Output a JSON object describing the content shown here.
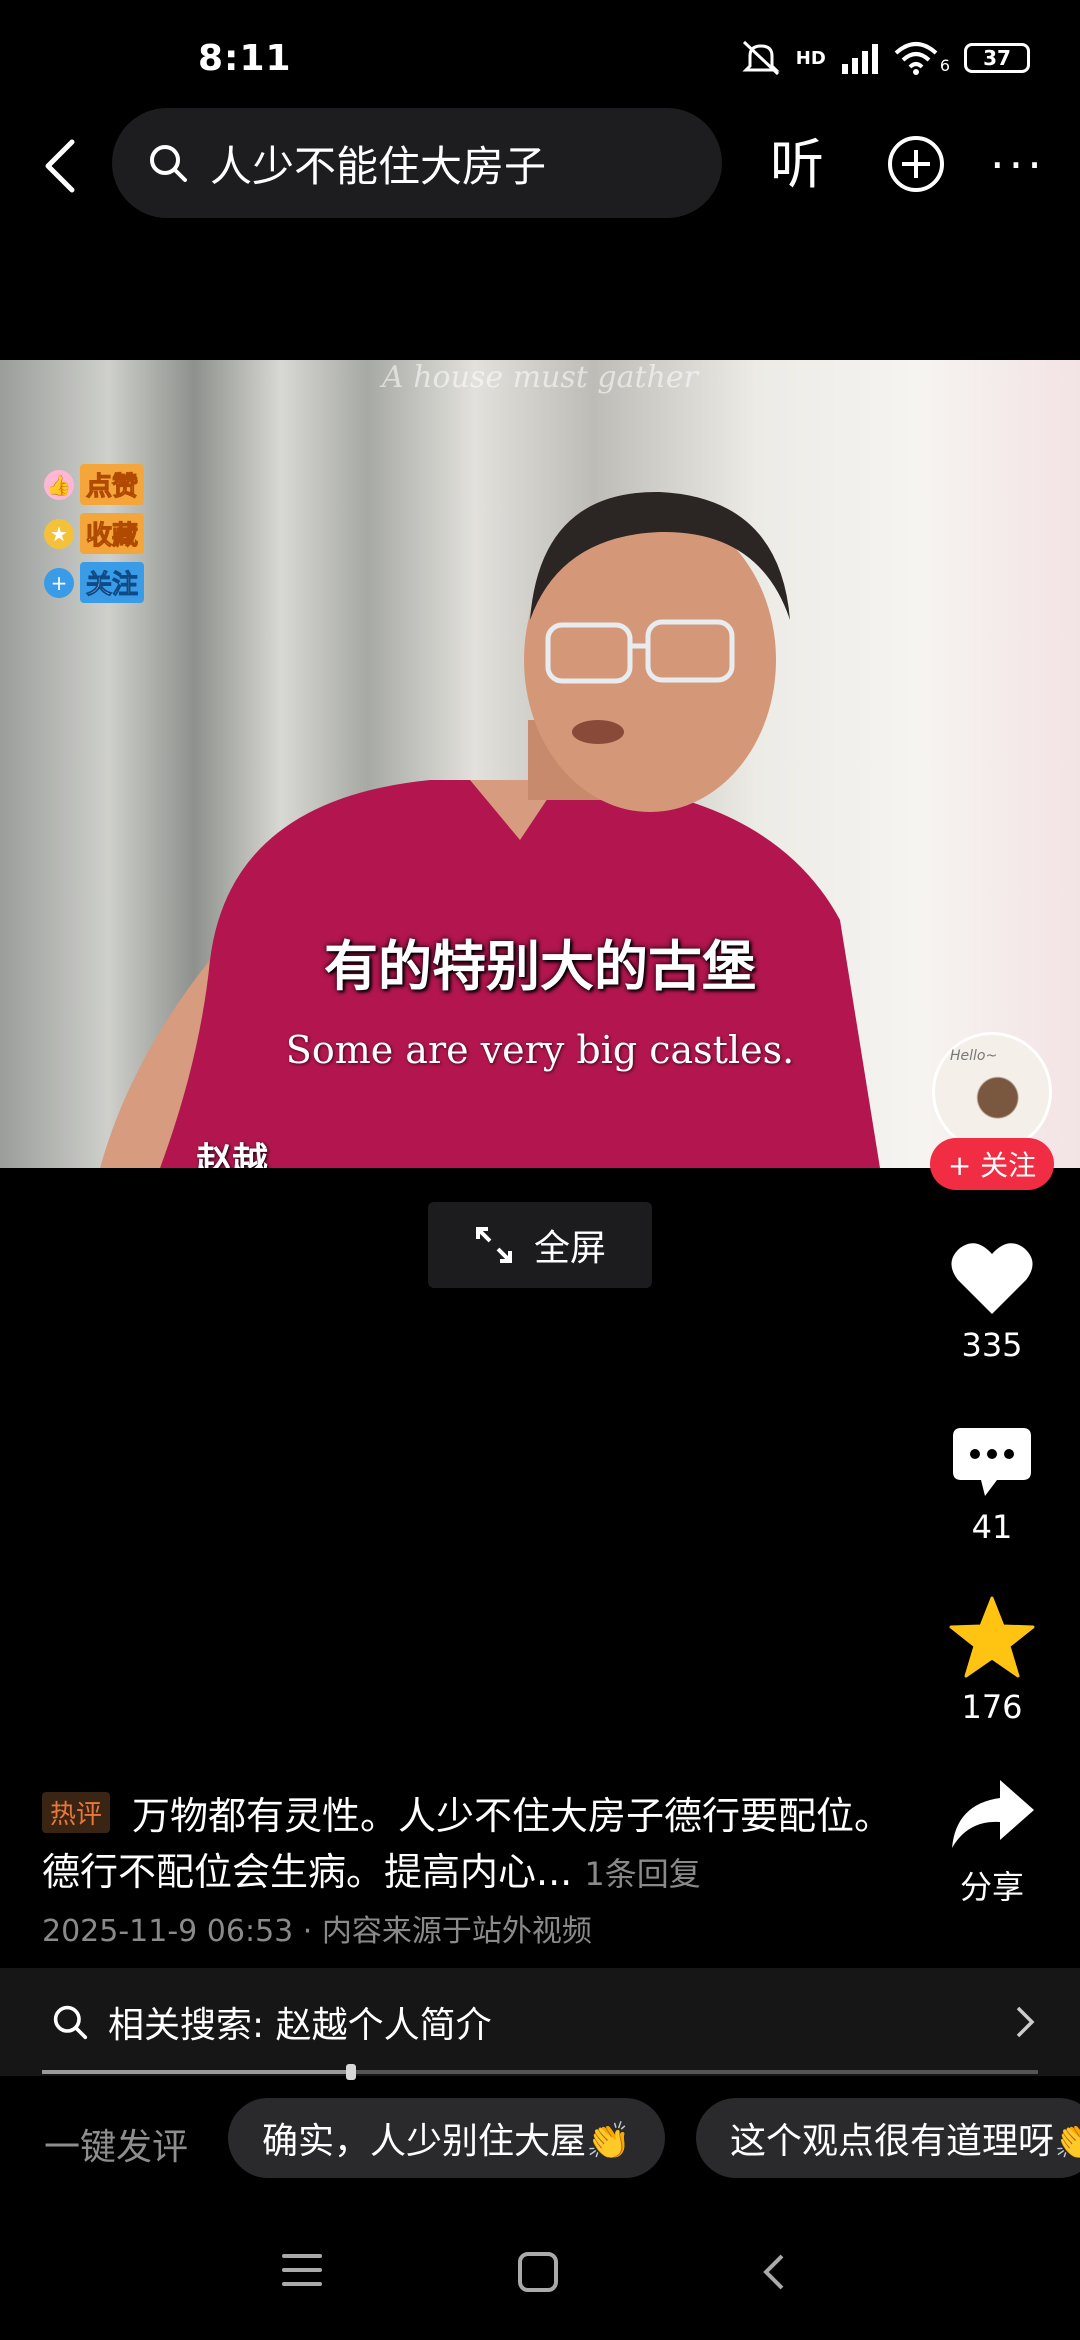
{
  "status_bar": {
    "time": "8:11",
    "battery": "37",
    "network": "HD",
    "wifi_badge": "6"
  },
  "top_bar": {
    "search_query": "人少不能住大房子",
    "listen_label": "听"
  },
  "video": {
    "top_caption": "A house must gather",
    "badges": [
      {
        "icon": "thumbs-up-icon",
        "label": "点赞"
      },
      {
        "icon": "star-icon",
        "label": "收藏"
      },
      {
        "icon": "plus-icon",
        "label": "关注"
      }
    ],
    "caption_cn": "有的特别大的古堡",
    "caption_en": "Some are very big castles.",
    "name_tag": "赵越"
  },
  "fullscreen_label": "全屏",
  "author": {
    "avatar_text": "Hello~",
    "follow_label": "+ 关注"
  },
  "actions": {
    "likes": "335",
    "comments": "41",
    "favorites": "176",
    "share_label": "分享"
  },
  "hot_comment": {
    "badge": "热评",
    "text": "万物都有灵性。人少不住大房子德行要配位。德行不配位会生病。提高内心...",
    "reply_count": "1条回复",
    "meta": "2025-11-9 06:53 · 内容来源于站外视频"
  },
  "related_search": {
    "label": "相关搜索: 赵越个人简介"
  },
  "progress": {
    "played_fraction": 0.31
  },
  "quick_reply": {
    "label": "一键发评",
    "chips": [
      "确实，人少别住大屋👏",
      "这个观点很有道理呀👏"
    ]
  }
}
